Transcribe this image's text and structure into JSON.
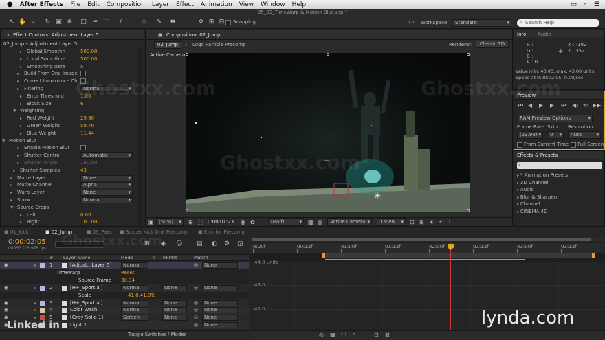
{
  "menubar": {
    "apple": "",
    "app_name": "After Effects",
    "items": [
      "File",
      "Edit",
      "Composition",
      "Layer",
      "Effect",
      "Animation",
      "View",
      "Window",
      "Help"
    ]
  },
  "toolbar": {
    "file_title": "05_03_TimeWarp & Motion Blur.aep *",
    "snapping_label": "Snapping",
    "workspace_label": "Workspace:",
    "workspace_value": "Standard",
    "search_placeholder": "Search Help"
  },
  "effect_controls": {
    "tab_label": "Effect Controls: Adjustment Layer 5",
    "breadcrumb": "02_Jump • Adjustment Layer 5",
    "rows": [
      {
        "label": "Global Smoothn",
        "value": "500.00"
      },
      {
        "label": "Local Smoothne",
        "value": "500.00"
      },
      {
        "label": "Smoothing Itera",
        "value": "5"
      },
      {
        "label": "Build From One Image",
        "value": ""
      },
      {
        "label": "Correct Luminance Ch",
        "value": ""
      },
      {
        "label": "Filtering",
        "value": "Normal"
      },
      {
        "label": "Error Threshold",
        "value": "1.00"
      },
      {
        "label": "Block Size",
        "value": "6"
      },
      {
        "label": "Weighting",
        "value": ""
      },
      {
        "label": "Red Weight",
        "value": "29.90"
      },
      {
        "label": "Green Weight",
        "value": "58.70"
      },
      {
        "label": "Blue Weight",
        "value": "11.44"
      },
      {
        "label": "Motion Blur",
        "value": ""
      },
      {
        "label": "Enable Motion Blur",
        "value": ""
      },
      {
        "label": "Shutter Control",
        "value": "Automatic"
      },
      {
        "label": "Shutter Angle",
        "value": "180.00"
      },
      {
        "label": "Shutter Samples",
        "value": "43"
      },
      {
        "label": "Matte Layer",
        "value": "None"
      },
      {
        "label": "Matte Channel",
        "value": "Alpha"
      },
      {
        "label": "Warp Layer",
        "value": "None"
      },
      {
        "label": "Show",
        "value": "Normal"
      },
      {
        "label": "Source Crops",
        "value": ""
      },
      {
        "label": "Left",
        "value": "0.00"
      },
      {
        "label": "Right",
        "value": "100.00"
      }
    ]
  },
  "composition": {
    "tab_label": "Composition: 02_Jump",
    "comp_tabs": [
      "02_Jump",
      "Logo Particle Precomp"
    ],
    "renderer_label": "Renderer:",
    "renderer_value": "Classic 3D",
    "camera_label": "Active Camera",
    "zoom": "(50%)",
    "timecode": "0:00:01:23",
    "resolution": "(Half)",
    "camera_select": "Active Camera",
    "view_select": "1 View",
    "exposure": "+0.0"
  },
  "info": {
    "tabs": [
      "Info",
      "Audio"
    ],
    "r": "R :",
    "g": "G :",
    "b": "B :",
    "a": "A : 0",
    "x": "X : -182",
    "y": "Y : 352",
    "value_range": "Value min: 43.00, max: 43.00 units",
    "speed": "Speed at 0:00:02:05: 0.00/sec"
  },
  "preview": {
    "tab": "Preview",
    "ram_preview": "RAM Preview Options",
    "frame_rate_label": "Frame Rate",
    "skip_label": "Skip",
    "resolution_label": "Resolution",
    "frame_rate_value": "(23.98)",
    "skip_value": "0",
    "resolution_value": "Auto",
    "from_current": "From Current Time",
    "full_screen": "Full Screen"
  },
  "effects_presets": {
    "tab": "Effects & Presets",
    "items": [
      "* Animation Presets",
      "3D Channel",
      "Audio",
      "Blur & Sharpen",
      "Channel",
      "CINEMA 4D"
    ]
  },
  "timeline": {
    "tabs": [
      "01_Kick",
      "02_Jump",
      "03_Pass",
      "Soccer Kick One Precomp",
      "Kick for Precomp"
    ],
    "timecode": "0:00:02:05",
    "frame_info": "00053 (23.976 fps)",
    "columns": [
      "#",
      "Layer Name",
      "Mode",
      "T",
      "TrkMat",
      "Parent"
    ],
    "ruler": [
      "0:00f",
      "00:12f",
      "01:00f",
      "01:12f",
      "02:00f",
      "02:12f",
      "03:00f",
      "03:12f"
    ],
    "graph_labels": [
      "44.0 units",
      "43.0",
      "42.0"
    ],
    "toggle": "Toggle Switches / Modes",
    "layers": [
      {
        "num": "1",
        "name": "[Adjust...Layer 5]",
        "mode": "Normal",
        "trkmat": "",
        "parent": "None",
        "color": "#b6b6e6"
      },
      {
        "num": "",
        "name": "Timewarp",
        "mode": "Reset",
        "trkmat": "",
        "parent": "",
        "color": ""
      },
      {
        "num": "",
        "name": "Source Frame",
        "mode": "30.34",
        "trkmat": "",
        "parent": "",
        "color": ""
      },
      {
        "num": "2",
        "name": "[H+_Sport.ai]",
        "mode": "Normal",
        "trkmat": "None",
        "parent": "None",
        "color": "#b6b6e6"
      },
      {
        "num": "",
        "name": "Scale",
        "mode": "41.0,41.0%",
        "trkmat": "",
        "parent": "",
        "color": ""
      },
      {
        "num": "3",
        "name": "[H+_Sport.ai]",
        "mode": "Normal",
        "trkmat": "None",
        "parent": "None",
        "color": "#b6b6e6"
      },
      {
        "num": "4",
        "name": "Color Wash",
        "mode": "Normal",
        "trkmat": "None",
        "parent": "None",
        "color": "#d8c8a8"
      },
      {
        "num": "5",
        "name": "[Gray Solid 1]",
        "mode": "Screen",
        "trkmat": "None",
        "parent": "None",
        "color": "#d04848"
      },
      {
        "num": "6",
        "name": "Light 1",
        "mode": "",
        "trkmat": "",
        "parent": "None",
        "color": "#d8c8a8"
      }
    ]
  },
  "watermarks": {
    "ghost": "Ghostxx.com",
    "lynda": "lynda.com",
    "linkedin": "Linked in"
  },
  "colors": {
    "accent_orange": "#e6a02a",
    "playhead_red": "#d23a3a",
    "work_area_green": "#4bd04b",
    "timeline_blue": "#2d59a8"
  }
}
